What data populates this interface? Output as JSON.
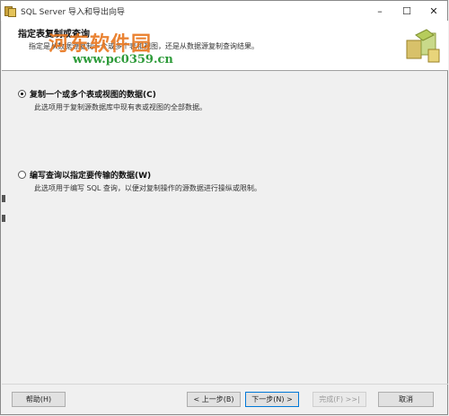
{
  "window": {
    "title": "SQL Server 导入和导出向导",
    "controls": {
      "minimize": "–",
      "maximize": "☐",
      "close": "✕"
    }
  },
  "header": {
    "title": "指定表复制或查询",
    "description": "指定是从数据源复制一个或多个表和视图，还是从数据源复制查询结果。"
  },
  "watermark": {
    "logo": "河东软件园",
    "url": "www.pc0359.cn"
  },
  "options": [
    {
      "label": "复制一个或多个表或视图的数据(C)",
      "description": "此选项用于复制源数据库中现有表或视图的全部数据。",
      "checked": true
    },
    {
      "label": "编写查询以指定要传输的数据(W)",
      "description": "此选项用于编写 SQL 查询，以便对复制操作的源数据进行操纵或限制。",
      "checked": false
    }
  ],
  "footer": {
    "help": "帮助(H)",
    "back": "< 上一步(B)",
    "next": "下一步(N) >",
    "finish": "完成(F) >>|",
    "cancel": "取消"
  },
  "colors": {
    "accent": "#0078d7",
    "watermark_orange": "#e8761e",
    "watermark_green": "#2e9b3a"
  },
  "icons": [
    "app-icon",
    "header-graphic-icon",
    "minimize-icon",
    "maximize-icon",
    "close-icon"
  ]
}
